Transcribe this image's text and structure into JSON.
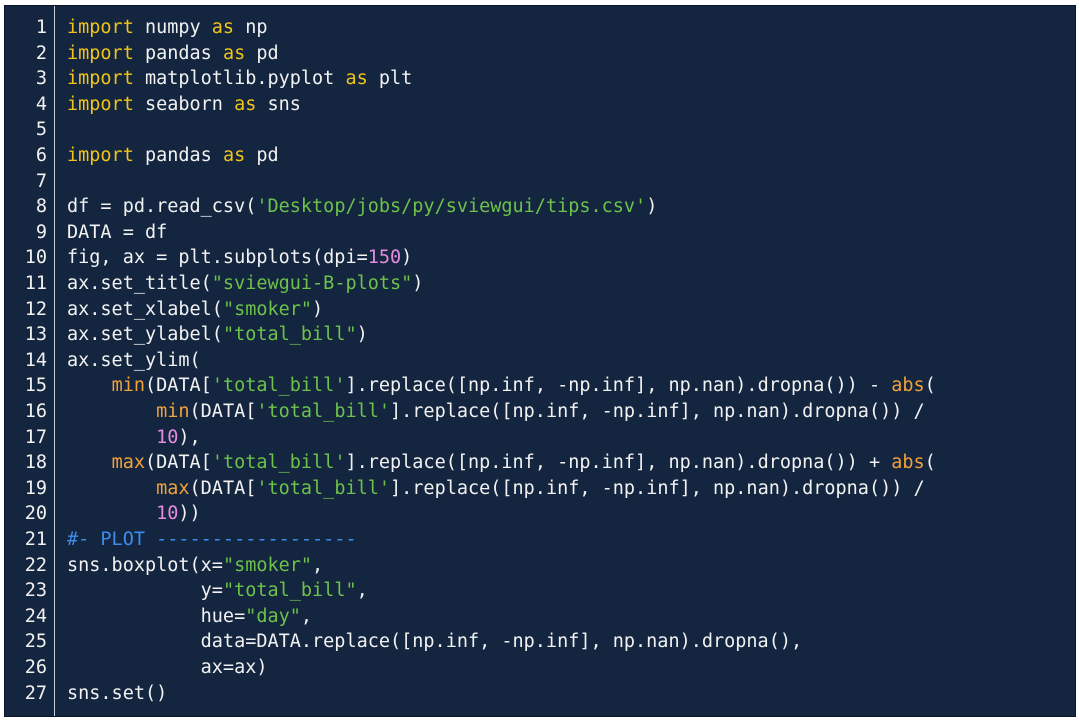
{
  "editor": {
    "colors": {
      "background": "#14253f",
      "text": "#f2f2f2",
      "keyword": "#f0c419",
      "string": "#6cc24a",
      "number": "#e58be0",
      "builtin": "#f2a13b",
      "comment": "#3b8ef0"
    },
    "lines": [
      {
        "n": "1",
        "tokens": [
          {
            "t": "import",
            "c": "kw"
          },
          {
            "t": " numpy "
          },
          {
            "t": "as",
            "c": "kw"
          },
          {
            "t": " np"
          }
        ]
      },
      {
        "n": "2",
        "tokens": [
          {
            "t": "import",
            "c": "kw"
          },
          {
            "t": " pandas "
          },
          {
            "t": "as",
            "c": "kw"
          },
          {
            "t": " pd"
          }
        ]
      },
      {
        "n": "3",
        "tokens": [
          {
            "t": "import",
            "c": "kw"
          },
          {
            "t": " matplotlib.pyplot "
          },
          {
            "t": "as",
            "c": "kw"
          },
          {
            "t": " plt"
          }
        ]
      },
      {
        "n": "4",
        "tokens": [
          {
            "t": "import",
            "c": "kw"
          },
          {
            "t": " seaborn "
          },
          {
            "t": "as",
            "c": "kw"
          },
          {
            "t": " sns"
          }
        ]
      },
      {
        "n": "5",
        "tokens": []
      },
      {
        "n": "6",
        "tokens": [
          {
            "t": "import",
            "c": "kw"
          },
          {
            "t": " pandas "
          },
          {
            "t": "as",
            "c": "kw"
          },
          {
            "t": " pd"
          }
        ]
      },
      {
        "n": "7",
        "tokens": []
      },
      {
        "n": "8",
        "tokens": [
          {
            "t": "df = pd.read_csv("
          },
          {
            "t": "'Desktop/jobs/py/sviewgui/tips.csv'",
            "c": "str"
          },
          {
            "t": ")"
          }
        ]
      },
      {
        "n": "9",
        "tokens": [
          {
            "t": "DATA = df"
          }
        ]
      },
      {
        "n": "10",
        "tokens": [
          {
            "t": "fig, ax = plt.subplots(dpi="
          },
          {
            "t": "150",
            "c": "num"
          },
          {
            "t": ")"
          }
        ]
      },
      {
        "n": "11",
        "tokens": [
          {
            "t": "ax.set_title("
          },
          {
            "t": "\"sviewgui-B-plots\"",
            "c": "str"
          },
          {
            "t": ")"
          }
        ]
      },
      {
        "n": "12",
        "tokens": [
          {
            "t": "ax.set_xlabel("
          },
          {
            "t": "\"smoker\"",
            "c": "str"
          },
          {
            "t": ")"
          }
        ]
      },
      {
        "n": "13",
        "tokens": [
          {
            "t": "ax.set_ylabel("
          },
          {
            "t": "\"total_bill\"",
            "c": "str"
          },
          {
            "t": ")"
          }
        ]
      },
      {
        "n": "14",
        "tokens": [
          {
            "t": "ax.set_ylim("
          }
        ]
      },
      {
        "n": "15",
        "tokens": [
          {
            "t": "    "
          },
          {
            "t": "min",
            "c": "fn"
          },
          {
            "t": "(DATA["
          },
          {
            "t": "'total_bill'",
            "c": "str"
          },
          {
            "t": "].replace([np.inf, -np.inf], np.nan).dropna()) - "
          },
          {
            "t": "abs",
            "c": "fn"
          },
          {
            "t": "("
          }
        ]
      },
      {
        "n": "16",
        "tokens": [
          {
            "t": "        "
          },
          {
            "t": "min",
            "c": "fn"
          },
          {
            "t": "(DATA["
          },
          {
            "t": "'total_bill'",
            "c": "str"
          },
          {
            "t": "].replace([np.inf, -np.inf], np.nan).dropna()) /"
          }
        ]
      },
      {
        "n": "17",
        "tokens": [
          {
            "t": "        "
          },
          {
            "t": "10",
            "c": "num"
          },
          {
            "t": "),"
          }
        ]
      },
      {
        "n": "18",
        "tokens": [
          {
            "t": "    "
          },
          {
            "t": "max",
            "c": "fn"
          },
          {
            "t": "(DATA["
          },
          {
            "t": "'total_bill'",
            "c": "str"
          },
          {
            "t": "].replace([np.inf, -np.inf], np.nan).dropna()) + "
          },
          {
            "t": "abs",
            "c": "fn"
          },
          {
            "t": "("
          }
        ]
      },
      {
        "n": "19",
        "tokens": [
          {
            "t": "        "
          },
          {
            "t": "max",
            "c": "fn"
          },
          {
            "t": "(DATA["
          },
          {
            "t": "'total_bill'",
            "c": "str"
          },
          {
            "t": "].replace([np.inf, -np.inf], np.nan).dropna()) /"
          }
        ]
      },
      {
        "n": "20",
        "tokens": [
          {
            "t": "        "
          },
          {
            "t": "10",
            "c": "num"
          },
          {
            "t": "))"
          }
        ]
      },
      {
        "n": "21",
        "tokens": [
          {
            "t": "#- PLOT ------------------",
            "c": "cm"
          }
        ]
      },
      {
        "n": "22",
        "tokens": [
          {
            "t": "sns.boxplot(x="
          },
          {
            "t": "\"smoker\"",
            "c": "str"
          },
          {
            "t": ","
          }
        ]
      },
      {
        "n": "23",
        "tokens": [
          {
            "t": "            y="
          },
          {
            "t": "\"total_bill\"",
            "c": "str"
          },
          {
            "t": ","
          }
        ]
      },
      {
        "n": "24",
        "tokens": [
          {
            "t": "            hue="
          },
          {
            "t": "\"day\"",
            "c": "str"
          },
          {
            "t": ","
          }
        ]
      },
      {
        "n": "25",
        "tokens": [
          {
            "t": "            data=DATA.replace([np.inf, -np.inf], np.nan).dropna(),"
          }
        ]
      },
      {
        "n": "26",
        "tokens": [
          {
            "t": "            ax=ax)"
          }
        ]
      },
      {
        "n": "27",
        "tokens": [
          {
            "t": "sns.set()"
          }
        ]
      }
    ]
  }
}
